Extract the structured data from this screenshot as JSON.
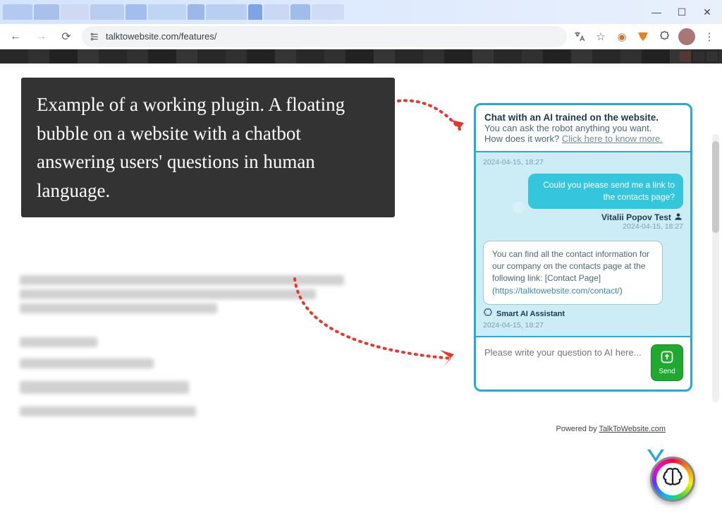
{
  "browser": {
    "url": "talktowebsite.com/features/"
  },
  "annotation": {
    "text": "Example of a working plugin. A floating bubble on a website with a chatbot answering users' questions in human language."
  },
  "chat": {
    "header_bold": "Chat with an AI trained on the website.",
    "header_line2": "You can ask the robot anything you want.",
    "header_line3_prefix": "How does it work? ",
    "header_link": "Click here to know more.",
    "top_timestamp": "2024-04-15, 18:27",
    "user_msg": "Could you please send me a link to the contacts page?",
    "user_name": "Vitalii Popov Test",
    "user_ts": "2024-04-15, 18:27",
    "bot_msg_prefix": "You can find all the contact information for our company on the contacts page at the following link: [Contact Page] (",
    "bot_msg_link": "https://talktowebsite.com/contact/",
    "bot_msg_suffix": ")",
    "bot_name": "Smart AI Assistant",
    "bot_ts": "2024-04-15, 18:27",
    "input_placeholder": "Please write your question to AI here...",
    "send_label": "Send",
    "powered_prefix": "Powered by ",
    "powered_link": "TalkToWebsite.com"
  }
}
